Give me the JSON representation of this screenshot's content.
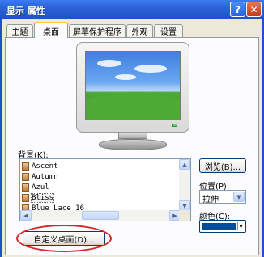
{
  "window": {
    "title": "显示 属性",
    "help_glyph": "?",
    "close_glyph": "✕"
  },
  "tabs": [
    {
      "label": "主题",
      "active": false
    },
    {
      "label": "桌面",
      "active": true
    },
    {
      "label": "屏幕保护程序",
      "active": false
    },
    {
      "label": "外观",
      "active": false
    },
    {
      "label": "设置",
      "active": false
    }
  ],
  "background": {
    "label": "背景(K):",
    "items": [
      "Ascent",
      "Autumn",
      "Azul",
      "Bliss",
      "Blue Lace 16"
    ],
    "selected": "Bliss",
    "browse_label": "浏览(B)..."
  },
  "position": {
    "label": "位置(P):",
    "value": "拉伸"
  },
  "color": {
    "label": "颜色(C):",
    "value": "#004e98"
  },
  "customize_label": "自定义桌面(D)...",
  "annotation_color": "#d2282c",
  "icons": {
    "list_item": "picture-file-icon",
    "scroll_up": "▲",
    "scroll_down": "▼",
    "scroll_left": "◀",
    "scroll_right": "▶",
    "combo": "▼"
  }
}
